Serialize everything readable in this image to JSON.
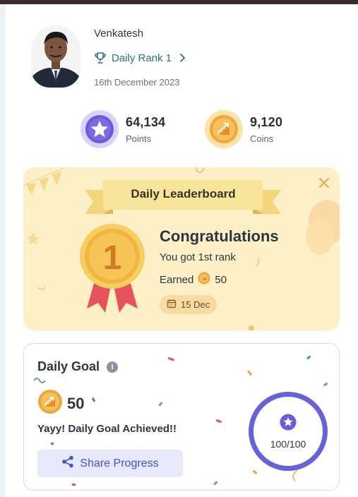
{
  "profile": {
    "name": "Venkatesh",
    "rank_label": "Daily Rank 1",
    "date": "16th December 2023"
  },
  "stats": {
    "points": {
      "value": "64,134",
      "label": "Points",
      "icon": "star-icon"
    },
    "coins": {
      "value": "9,120",
      "label": "Coins",
      "icon": "coin-stairs-icon"
    }
  },
  "leaderboard": {
    "title": "Daily Leaderboard",
    "heading": "Congratulations",
    "message": "You got 1st rank",
    "earned_label": "Earned",
    "earned_value": "50",
    "date": "15 Dec",
    "medal_number": "1"
  },
  "daily_goal": {
    "title": "Daily Goal",
    "coins": "50",
    "status": "Yayy! Daily Goal Achieved!!",
    "share_label": "Share Progress",
    "progress_text": "100/100",
    "progress_fraction": 1.0
  },
  "colors": {
    "accent_purple": "#6762dc",
    "card_yellow": "#fdf0c6",
    "rank_teal": "#2e6f86",
    "medal_gold": "#f2b640",
    "ribbon_red": "#e8525d"
  }
}
